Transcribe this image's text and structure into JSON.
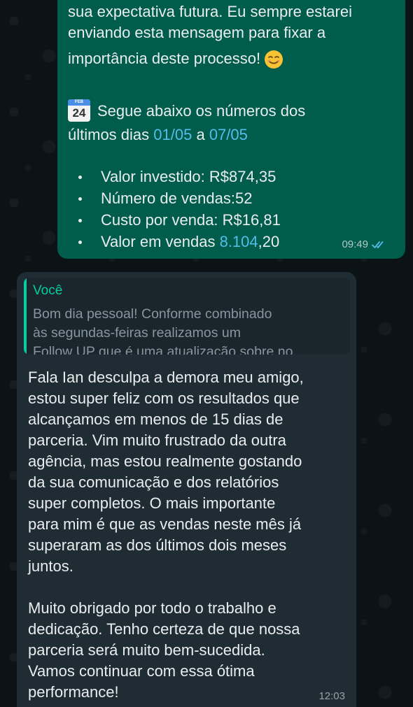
{
  "outgoing_message": {
    "lines": [
      "sua expectativa futura. Eu sempre estarei",
      "enviando esta mensagem para fixar a",
      "importância deste processo!"
    ],
    "calendar_icon": {
      "month": "FEB",
      "day": "24"
    },
    "numbers_intro": "Segue abaixo os números dos",
    "period_prefix": "últimos dias ",
    "date_start": "01/05",
    "period_connector": " a ",
    "date_end": "07/05",
    "bullets": [
      "Valor investido: R$874,35",
      "Número de vendas:52",
      "Custo por venda: R$16,81"
    ],
    "last_bullet_prefix": "Valor em vendas ",
    "last_bullet_link": "8.104",
    "last_bullet_suffix": ",20",
    "time": "09:49",
    "status_icon": "double-check-read-icon",
    "emoji": "smiling-face-icon"
  },
  "incoming_message": {
    "quote": {
      "author": "Você",
      "lines": [
        "Bom dia pessoal! Conforme combinado",
        "às segundas-feiras realizamos um",
        "Follow UP que é uma atualização sobre no..."
      ]
    },
    "lines": [
      "Fala Ian desculpa a demora meu amigo,",
      "estou super feliz com os resultados que",
      "alcançamos em menos de 15 dias de",
      "parceria. Vim muito frustrado da outra",
      "agência, mas estou realmente gostando",
      "da sua comunicação e dos relatórios",
      "super completos. O mais importante",
      "para mim é que as vendas neste mês já",
      "superaram as dos últimos dois meses",
      "juntos.",
      "",
      "Muito obrigado por todo o trabalho e",
      "dedicação. Tenho certeza de que nossa",
      "parceria será muito bem-sucedida.",
      "Vamos continuar com essa ótima",
      "performance!"
    ],
    "time": "12:03"
  },
  "colors": {
    "outgoing_bubble": "#005c4b",
    "incoming_bubble": "#202c33",
    "link": "#53bdeb",
    "quote_accent": "#06cf9c"
  }
}
